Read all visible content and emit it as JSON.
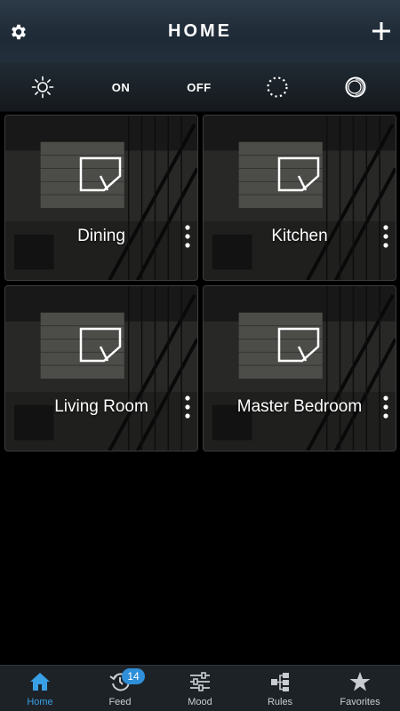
{
  "header": {
    "title": "HOME",
    "settings_icon": "gear-icon",
    "add_icon": "plus-icon"
  },
  "controls": {
    "brightness_icon": "sun-icon",
    "on_label": "ON",
    "off_label": "OFF",
    "dim_icon": "dotted-circle-icon",
    "scene_icon": "ring-circle-icon"
  },
  "rooms": [
    {
      "name": "Dining",
      "icon": "room-icon",
      "menu_icon": "more-vertical-icon"
    },
    {
      "name": "Kitchen",
      "icon": "room-icon",
      "menu_icon": "more-vertical-icon"
    },
    {
      "name": "Living Room",
      "icon": "room-icon",
      "menu_icon": "more-vertical-icon"
    },
    {
      "name": "Master Bedroom",
      "icon": "room-icon",
      "menu_icon": "more-vertical-icon"
    }
  ],
  "bottom_nav": {
    "items": [
      {
        "label": "Home",
        "icon": "house-icon",
        "active": true
      },
      {
        "label": "Feed",
        "icon": "history-icon",
        "badge": "14"
      },
      {
        "label": "Mood",
        "icon": "sliders-icon"
      },
      {
        "label": "Rules",
        "icon": "flow-icon"
      },
      {
        "label": "Favorites",
        "icon": "star-icon"
      }
    ]
  },
  "colors": {
    "accent": "#3aa0e6",
    "badge": "#2f8fd8",
    "nav_bg": "#1d2227",
    "header_bg": "#2c3a47"
  }
}
